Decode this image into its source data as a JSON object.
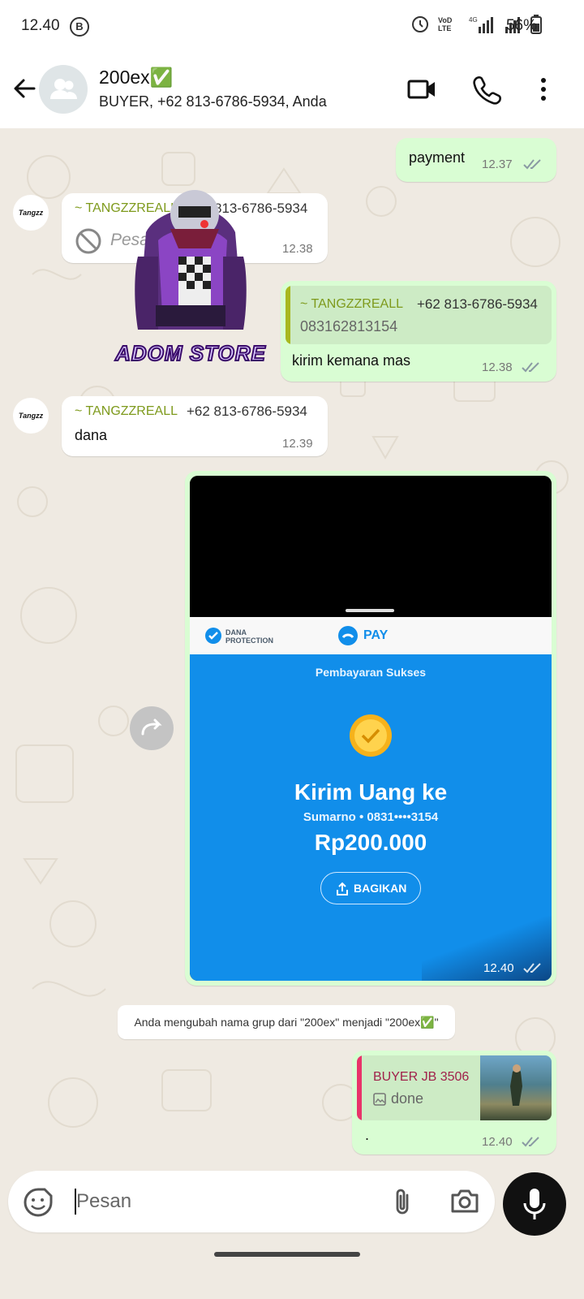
{
  "status_bar": {
    "time": "12.40",
    "network_label": "VoD LTE",
    "battery_percent": "56%",
    "icons": [
      "b-icon",
      "sync-icon",
      "volte-icon",
      "signal-icon",
      "signal-icon",
      "battery-icon"
    ]
  },
  "header": {
    "title": "200ex✅",
    "subtitle": "BUYER, +62 813-6786-5934, Anda",
    "icons": [
      "back-arrow-icon",
      "group-avatar-icon",
      "video-call-icon",
      "phone-icon",
      "more-vert-icon"
    ]
  },
  "messages": [
    {
      "type": "out",
      "text": "payment",
      "time": "12.37",
      "status": "read"
    },
    {
      "type": "in",
      "sender": "~ TANGZZREALL",
      "phone": "813-6786-5934",
      "text": "Pesan dihapus",
      "deleted": true,
      "time": "12.38",
      "avatar_text": "Tangzz"
    },
    {
      "type": "sticker",
      "sticker_text": "ADOM STORE"
    },
    {
      "type": "out_reply",
      "quoted_sender": "~ TANGZZREALL",
      "quoted_phone": "+62 813-6786-5934",
      "quoted_text": "083162813154",
      "text": "kirim kemana mas",
      "time": "12.38",
      "status": "read"
    },
    {
      "type": "in",
      "sender": "~ TANGZZREALL",
      "phone": "+62 813-6786-5934",
      "text": "dana",
      "time": "12.39",
      "avatar_text": "Tangzz"
    },
    {
      "type": "out_image",
      "time": "12.40",
      "status": "read",
      "receipt": {
        "protection_label": "DANA PROTECTION",
        "pay_label": "PAY",
        "status": "Pembayaran Sukses",
        "headline": "Kirim Uang ke",
        "recipient": "Sumarno • 0831••••3154",
        "amount": "Rp200.000",
        "share_button": "BAGIKAN"
      }
    },
    {
      "type": "system",
      "text": "Anda mengubah nama grup dari \"200ex\" menjadi \"200ex✅\""
    },
    {
      "type": "out_reply_image",
      "quoted_sender": "BUYER JB 3506",
      "quoted_text": "done",
      "text": ".",
      "time": "12.40",
      "status": "read"
    }
  ],
  "composer": {
    "placeholder": "Pesan",
    "icons": [
      "sticker-icon",
      "attach-icon",
      "camera-icon",
      "mic-icon"
    ]
  },
  "colors": {
    "outgoing_bubble": "#d9fdd3",
    "incoming_bubble": "#ffffff",
    "chat_background": "#efeae2",
    "sender_name": "#7e9a1c",
    "read_ticks": "#8a9aa3",
    "dana_blue": "#118eea"
  }
}
